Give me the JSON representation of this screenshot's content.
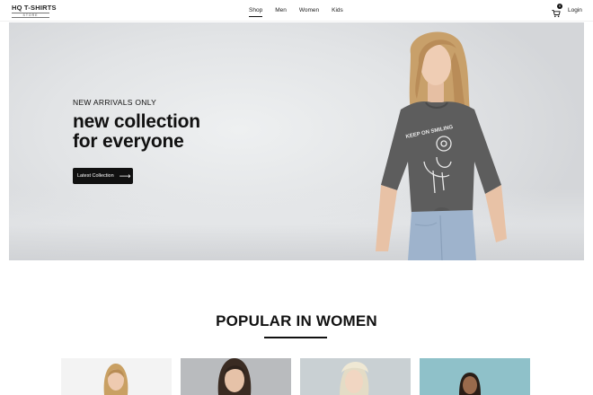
{
  "header": {
    "logo_main": "HQ T-SHIRTS",
    "logo_sub": "STORE",
    "nav": [
      {
        "label": "Shop",
        "active": true
      },
      {
        "label": "Men",
        "active": false
      },
      {
        "label": "Women",
        "active": false
      },
      {
        "label": "Kids",
        "active": false
      }
    ],
    "cart_count": "0",
    "login_label": "Login"
  },
  "hero": {
    "tagline": "NEW ARRIVALS ONLY",
    "title_line1": "new collection",
    "title_line2": "for everyone",
    "button_label": "Latest Collection",
    "shirt_print": "KEEP ON SMILING"
  },
  "popular": {
    "title": "POPULAR IN WOMEN",
    "cards": [
      {
        "bg": "#f3f3f3",
        "hair": "#c9a063"
      },
      {
        "bg": "#b9bbbe",
        "hair": "#3a2b22"
      },
      {
        "bg": "#c9d0d3",
        "hair": "#e4dcc6"
      },
      {
        "bg": "#8fc1c9",
        "hair": "#2a1d16"
      }
    ]
  },
  "colors": {
    "accent": "#111111"
  }
}
